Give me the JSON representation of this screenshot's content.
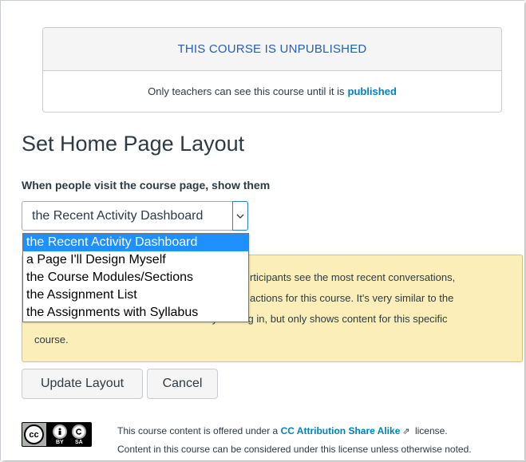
{
  "notice": {
    "heading": "THIS COURSE IS UNPUBLISHED",
    "body_prefix": "Only teachers can see this course until it is",
    "body_link": "published"
  },
  "page": {
    "title": "Set Home Page Layout",
    "prompt": "When people visit the course page, show them"
  },
  "layout_select": {
    "selected": "the Recent Activity Dashboard",
    "options": [
      "the Recent Activity Dashboard",
      "a Page I'll Design Myself",
      "the Course Modules/Sections",
      "the Assignment List",
      "the Assignments with Syllabus"
    ]
  },
  "info_box": {
    "line1": "rticipants see the most recent conversations,",
    "line2": "actions for this course. It's very similar to the",
    "line3": "he user dashboard users see when they first log in, but only shows content for this specific",
    "line4": "course."
  },
  "buttons": {
    "update": "Update Layout",
    "cancel": "Cancel"
  },
  "license": {
    "line1_prefix": "This course content is offered under a",
    "link": "CC Attribution Share Alike",
    "line1_suffix": "license.",
    "line2": "Content in this course can be considered under this license unless otherwise noted.",
    "badge_cc": "cc",
    "badge_by": "BY",
    "badge_sa": "SA"
  },
  "colors": {
    "accent": "#2a5db0",
    "link": "#0081bd",
    "warning_bg": "#fbeeb8",
    "selected_bg": "#1e90ff"
  }
}
